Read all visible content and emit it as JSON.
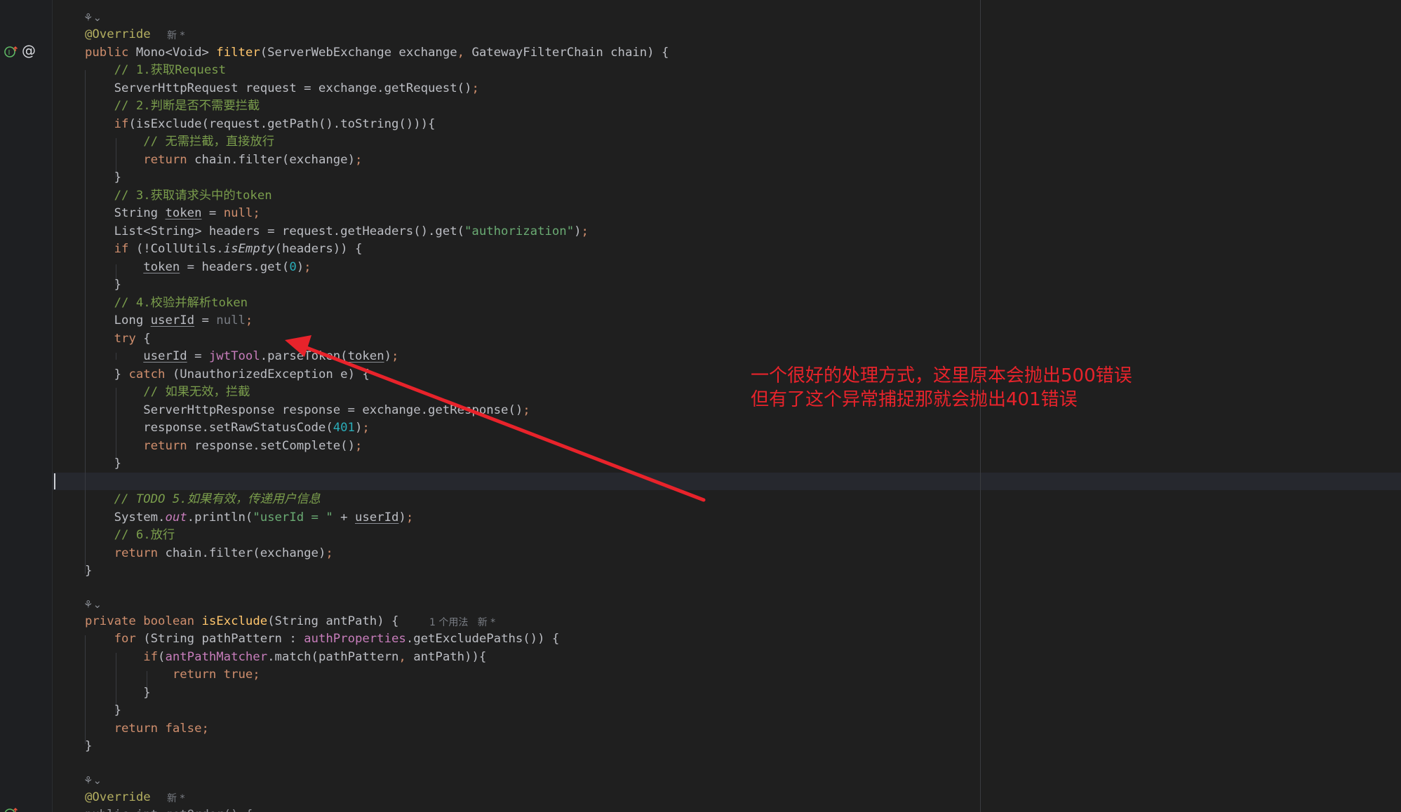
{
  "gutter": {
    "implements_icon": "implements-override-icon",
    "at_icon": "@",
    "bottom_icon": "implements-override-icon"
  },
  "code": {
    "l_fold1": "⚘⌄",
    "l1_ann": "@Override",
    "l1_hint": "新 *",
    "l2_kw": "public",
    "l2_type": " Mono<Void> ",
    "l2_fn": "filter",
    "l2_rest1": "(ServerWebExchange exchange",
    "l2_comma": ",",
    "l2_rest2": " GatewayFilterChain chain) {",
    "l3": "    // 1.获取Request",
    "l4_a": "    ServerHttpRequest request = exchange.getRequest()",
    "l4_b": ";",
    "l5": "    // 2.判断是否不需要拦截",
    "l6_kw": "    if",
    "l6_rest": "(isExclude(request.getPath().toString())){",
    "l7": "        // 无需拦截，直接放行",
    "l8_kw": "        return",
    "l8_rest": " chain.filter(exchange)",
    "l8_semi": ";",
    "l9": "    }",
    "l10": "    // 3.获取请求头中的token",
    "l11_a": "    String ",
    "l11_var": "token",
    "l11_b": " = ",
    "l11_kw": "null",
    "l11_semi": ";",
    "l12_a": "    List<String> headers = request.getHeaders().get(",
    "l12_str": "\"authorization\"",
    "l12_b": ")",
    "l12_semi": ";",
    "l13_kw": "    if",
    "l13_a": " (!CollUtils.",
    "l13_it": "isEmpty",
    "l13_b": "(headers)) {",
    "l14_pre": "        ",
    "l14_var": "token",
    "l14_a": " = headers.get(",
    "l14_num": "0",
    "l14_b": ")",
    "l14_semi": ";",
    "l15": "    }",
    "l16": "    // 4.校验并解析token",
    "l17_a": "    Long ",
    "l17_var": "userId",
    "l17_b": " = ",
    "l17_null": "null",
    "l17_semi": ";",
    "l18_kw": "    try",
    "l18_b": " {",
    "l19_pre": "        ",
    "l19_var": "userId",
    "l19_a": " = ",
    "l19_fld": "jwtTool",
    "l19_b": ".parseToken(",
    "l19_var2": "token",
    "l19_c": ")",
    "l19_semi": ";",
    "l20_a": "    } ",
    "l20_kw": "catch",
    "l20_b": " (UnauthorizedException e) {",
    "l21": "        // 如果无效，拦截",
    "l22_a": "        ServerHttpResponse response = exchange.getResponse()",
    "l22_semi": ";",
    "l23_a": "        response.setRawStatusCode(",
    "l23_num": "401",
    "l23_b": ")",
    "l23_semi": ";",
    "l24_kw": "        return",
    "l24_a": " response.setComplete()",
    "l24_semi": ";",
    "l25": "    }",
    "l27": "    // TODO 5.如果有效，传递用户信息",
    "l28_a": "    System.",
    "l28_out": "out",
    "l28_b": ".println(",
    "l28_str": "\"userId = \"",
    "l28_c": " + ",
    "l28_var": "userId",
    "l28_d": ")",
    "l28_semi": ";",
    "l29": "    // 6.放行",
    "l30_kw": "    return",
    "l30_a": " chain.filter(exchange)",
    "l30_semi": ";",
    "l31": "}",
    "l_fold2": "⚘⌄",
    "l33_kw": "private boolean",
    "l33_sp": " ",
    "l33_fn": "isExclude",
    "l33_rest": "(String antPath) {",
    "l33_hint": "1 个用法   新 *",
    "l34_kw": "    for",
    "l34_a": " (String pathPattern : ",
    "l34_fld": "authProperties",
    "l34_b": ".getExcludePaths()) {",
    "l35_kw": "        if",
    "l35_a": "(",
    "l35_fld": "antPathMatcher",
    "l35_b": ".match(pathPattern",
    "l35_comma": ",",
    "l35_c": " antPath)){",
    "l36_kw": "            return true",
    "l36_semi": ";",
    "l37": "        }",
    "l38": "    }",
    "l39_kw": "    return false",
    "l39_semi": ";",
    "l40": "}",
    "l_fold3": "⚘⌄",
    "l41_ann": "@Override",
    "l41_hint": "新 *",
    "l42_partial": "public int getOrder() {"
  },
  "annotation": {
    "line1": "一个很好的处理方式，这里原本会抛出500错误",
    "line2": "但有了这个异常捕捉那就会抛出401错误",
    "color": "#e8232b"
  }
}
